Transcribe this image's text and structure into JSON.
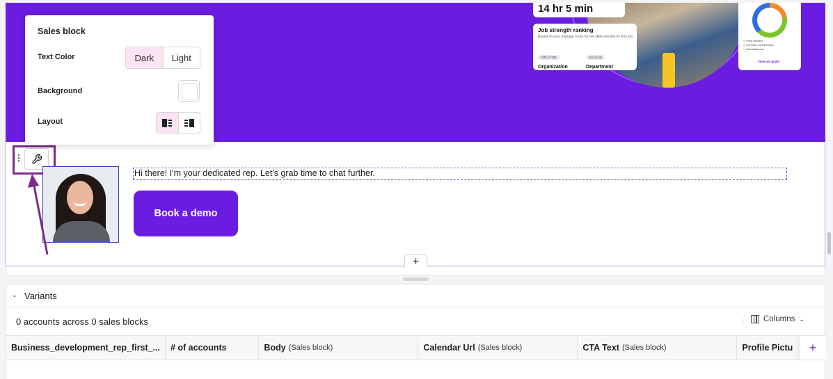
{
  "hero": {
    "time_card": "14 hr 5 min",
    "rank_card": {
      "title": "Job strength ranking",
      "subtitle": "Based on your average score for the skills needed for this job.",
      "org_pill": "10th of 105",
      "org_label": "Organization",
      "dept_pill": "2nd of 15",
      "dept_label": "Department"
    },
    "goal_card": {
      "legend": [
        "Price winners",
        "Premium membership",
        "Miscellaneous"
      ],
      "link": "View job goals"
    }
  },
  "settings_panel": {
    "title": "Sales block",
    "text_color_label": "Text Color",
    "text_color_options": [
      "Dark",
      "Light"
    ],
    "text_color_selected": "Dark",
    "background_label": "Background",
    "background_color": "#ffffff",
    "layout_label": "Layout"
  },
  "sales_block": {
    "body_text": "Hi there! I'm your dedicated rep. Let's grab time to chat further.",
    "cta_text": "Book a demo",
    "add_label": "+"
  },
  "variants": {
    "title": "Variants",
    "summary": "0 accounts across 0 sales blocks",
    "columns_label": "Columns",
    "table_headers": [
      {
        "label": "Business_development_rep_first_...",
        "sub": ""
      },
      {
        "label": "# of accounts",
        "sub": ""
      },
      {
        "label": "Body",
        "sub": "(Sales block)"
      },
      {
        "label": "Calendar Url",
        "sub": "(Sales block)"
      },
      {
        "label": "CTA Text",
        "sub": "(Sales block)"
      },
      {
        "label": "Profile Pictu",
        "sub": ""
      }
    ],
    "add_column_label": "+"
  },
  "colors": {
    "brand_purple": "#6a1de0",
    "selected_segment": "#fbe3f4",
    "highlight_box": "#7c2b8a"
  }
}
